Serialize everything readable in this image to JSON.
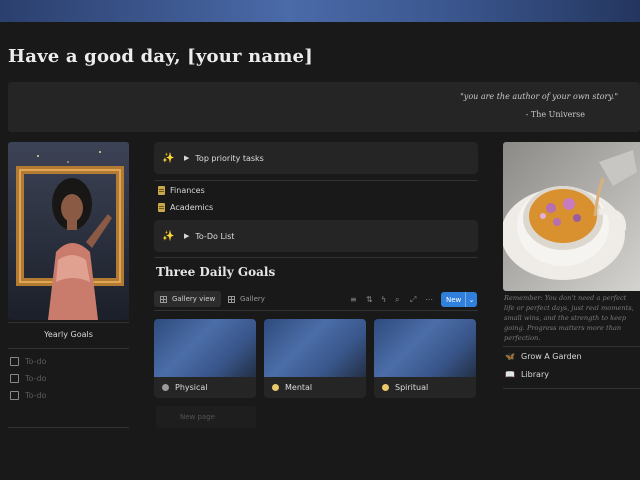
{
  "header": {
    "title": "Have a good day, [your name]"
  },
  "quote": {
    "text": "\"you are the author of your own story.\"",
    "author": "- The Universe"
  },
  "left": {
    "caption": "Yearly Goals",
    "todos": [
      "To-do",
      "To-do",
      "To-do"
    ]
  },
  "middle": {
    "toggles": {
      "top_priority": "Top priority tasks",
      "todo_list": "To-Do List"
    },
    "pages": [
      "Finances",
      "Academics"
    ],
    "goals_heading": "Three Daily Goals",
    "views": {
      "gallery_view": "Gallery view",
      "gallery": "Gallery"
    },
    "new_button": "New",
    "cards": [
      {
        "title": "Physical",
        "dot_color": "#9b9b9b"
      },
      {
        "title": "Mental",
        "dot_color": "#e8c86a"
      },
      {
        "title": "Spiritual",
        "dot_color": "#e8c86a"
      }
    ],
    "new_page": "New page"
  },
  "right": {
    "text": "Remember: You don't need a perfect life or perfect days, just real moments, small wins, and the strength to keep going. Progress matters more than perfection.",
    "links": [
      {
        "label": "Grow A Garden",
        "icon": "butterfly-icon"
      },
      {
        "label": "Library",
        "icon": "book-icon"
      }
    ]
  },
  "colors": {
    "accent": "#2f7fdb",
    "background": "#191919",
    "block": "#252525"
  }
}
